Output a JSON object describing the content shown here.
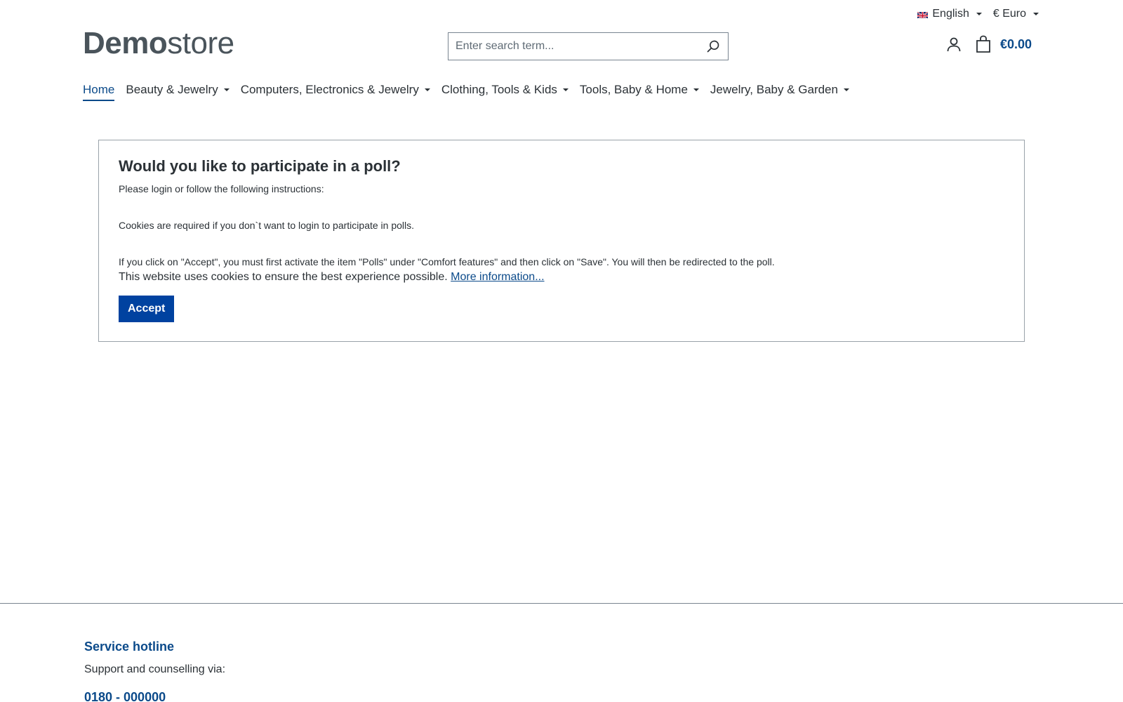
{
  "top_bar": {
    "language": "English",
    "currency": "€ Euro"
  },
  "header": {
    "logo_bold": "Demo",
    "logo_light": "store",
    "search_placeholder": "Enter search term...",
    "cart_total": "€0.00"
  },
  "nav": {
    "items": [
      {
        "label": "Home",
        "active": true
      },
      {
        "label": "Beauty & Jewelry"
      },
      {
        "label": "Computers, Electronics & Jewelry"
      },
      {
        "label": "Clothing, Tools & Kids"
      },
      {
        "label": "Tools, Baby & Home"
      },
      {
        "label": "Jewelry, Baby & Garden"
      }
    ]
  },
  "poll": {
    "title": "Would you like to participate in a poll?",
    "intro": "Please login or follow the following instructions:",
    "cookies_required": "Cookies are required if you don`t want to login to participate in polls.",
    "accept_instructions": "If you click on \"Accept\", you must first activate the item \"Polls\" under \"Comfort features\" and then click on \"Save\". You will then be redirected to the poll.",
    "cookie_notice": "This website uses cookies to ensure the best experience possible.",
    "more_info": "More information...",
    "accept_label": "Accept"
  },
  "footer": {
    "title": "Service hotline",
    "text": "Support and counselling via:",
    "phone": "0180 - 000000"
  },
  "colors": {
    "primary": "#0042a0",
    "link": "#0b4a8a",
    "text": "#2b3136",
    "border": "#798490"
  }
}
